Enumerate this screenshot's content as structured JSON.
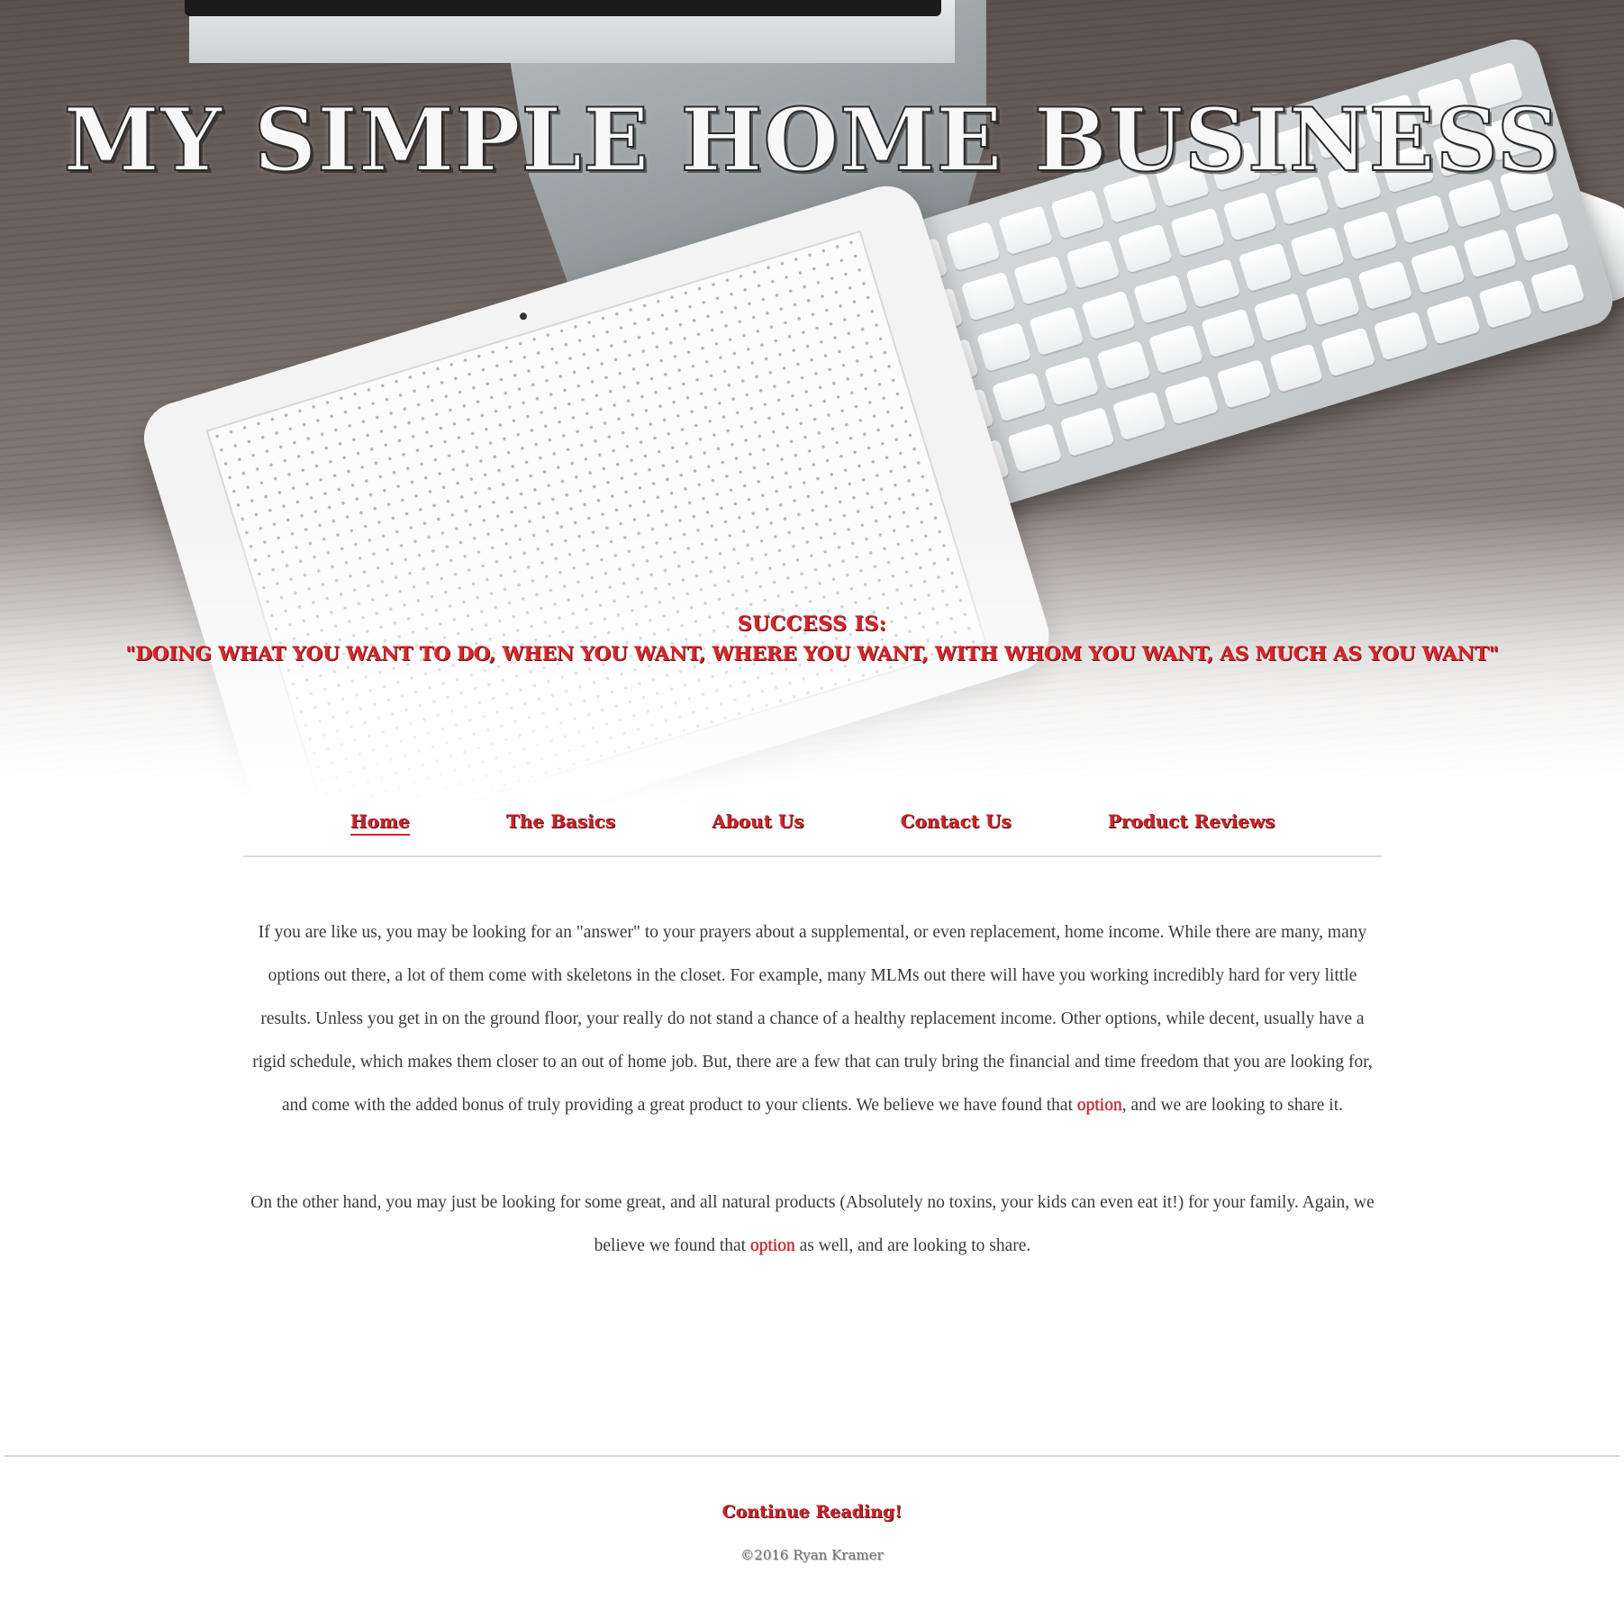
{
  "hero": {
    "title": "MY SIMPLE HOME BUSINESS",
    "tagline_head": "SUCCESS IS:",
    "tagline_quote": "\"DOING WHAT YOU WANT TO DO, WHEN YOU WANT, WHERE YOU WANT, WITH WHOM YOU WANT, AS MUCH AS YOU WANT\""
  },
  "nav": {
    "items": [
      {
        "label": "Home",
        "active": true
      },
      {
        "label": "The Basics"
      },
      {
        "label": "About Us"
      },
      {
        "label": "Contact Us"
      },
      {
        "label": "Product Reviews"
      }
    ]
  },
  "content": {
    "paragraph1_before": "If you are like us, you may be looking for an \"answer\" to your prayers about a supplemental, or even replacement, home income. While there are many, many options out there, a lot of them come with skeletons in the closet. For example, many MLMs out there will have you working incredibly hard for very little results. Unless you get in on the ground floor, your really do not stand a chance of a healthy replacement income. Other options, while decent, usually have a rigid schedule, which makes them closer to an out of home job. But, there are a few that can truly bring the financial and time freedom that you are looking for, and come with the added bonus of truly providing a great product to your clients. We believe we have found that ",
    "paragraph1_link": "option",
    "paragraph1_after": ", and we are looking to share it.",
    "paragraph2_before": "On the other hand, you may just be looking for some great, and all natural products (Absolutely no toxins, your kids can even eat it!) for your family. Again, we believe we found that ",
    "paragraph2_link": "option",
    "paragraph2_after": " as well, and are looking to share."
  },
  "footer": {
    "continue_label": "Continue Reading!",
    "copyright": "©2016 Ryan Kramer"
  },
  "colors": {
    "accent": "#c9252a",
    "text": "#3a3a3a",
    "rule": "#d9d9d9"
  }
}
